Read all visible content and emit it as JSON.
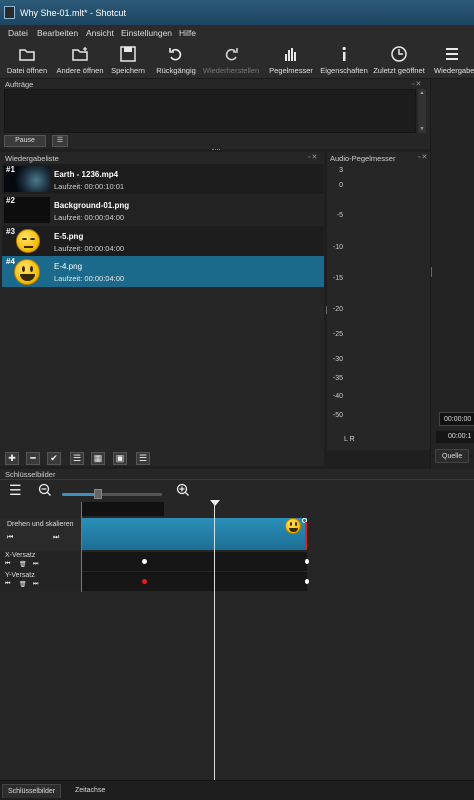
{
  "window": {
    "title": "Why She-01.mlt* - Shotcut"
  },
  "menu": [
    "Datei",
    "Bearbeiten",
    "Ansicht",
    "Einstellungen",
    "Hilfe"
  ],
  "toolbar": [
    {
      "label": "Datei öffnen",
      "icon": "folder-open-icon"
    },
    {
      "label": "Andere öffnen",
      "icon": "open-other-icon"
    },
    {
      "label": "Speichern",
      "icon": "save-icon"
    },
    {
      "label": "Rückgängig",
      "icon": "undo-icon"
    },
    {
      "label": "Wiederherstellen",
      "icon": "redo-icon",
      "disabled": true
    },
    {
      "label": "Pegelmesser",
      "icon": "meter-icon"
    },
    {
      "label": "Eigenschaften",
      "icon": "info-icon"
    },
    {
      "label": "Zuletzt geöffnet",
      "icon": "clock-icon"
    },
    {
      "label": "Wiedergabel",
      "icon": "playlist-icon"
    }
  ],
  "jobs": {
    "title": "Aufträge",
    "pause_label": "Pause",
    "menu_label": "☰"
  },
  "playlist": {
    "title": "Wiedergabeliste",
    "items": [
      {
        "num": "#1",
        "name": "Earth - 1236.mp4",
        "duration": "Laufzeit: 00:00:10:01"
      },
      {
        "num": "#2",
        "name": "Background-01.png",
        "duration": "Laufzeit: 00:00:04:00"
      },
      {
        "num": "#3",
        "name": "E-5.png",
        "duration": "Laufzeit: 00:00:04:00"
      },
      {
        "num": "#4",
        "name": "E-4.png",
        "duration": "Laufzeit: 00:00:04:00",
        "selected": true
      }
    ]
  },
  "audio": {
    "title": "Audio-Pegelmesser",
    "scale": [
      "3",
      "0",
      "-5",
      "-10",
      "-15",
      "-20",
      "-25",
      "-30",
      "-35",
      "-40",
      "-50"
    ],
    "channels": "L R"
  },
  "right_panel": {
    "time1": "00:00:00",
    "time2": "00:00:1",
    "source_tab": "Quelle"
  },
  "keyframes": {
    "title": "Schlüsselbilder",
    "filter_name": "Drehen und skalieren",
    "params": [
      "X-Versatz",
      "Y-Versatz"
    ],
    "colors": {
      "track": "#1d7fa8",
      "keyframe_white": "#ffffff",
      "keyframe_red": "#e02020"
    }
  },
  "bottom_tabs": [
    "Schlüsselbilder",
    "Zeitachse"
  ],
  "colors": {
    "selection": "#1b6a8c",
    "titlebar": "#2d5a78"
  }
}
